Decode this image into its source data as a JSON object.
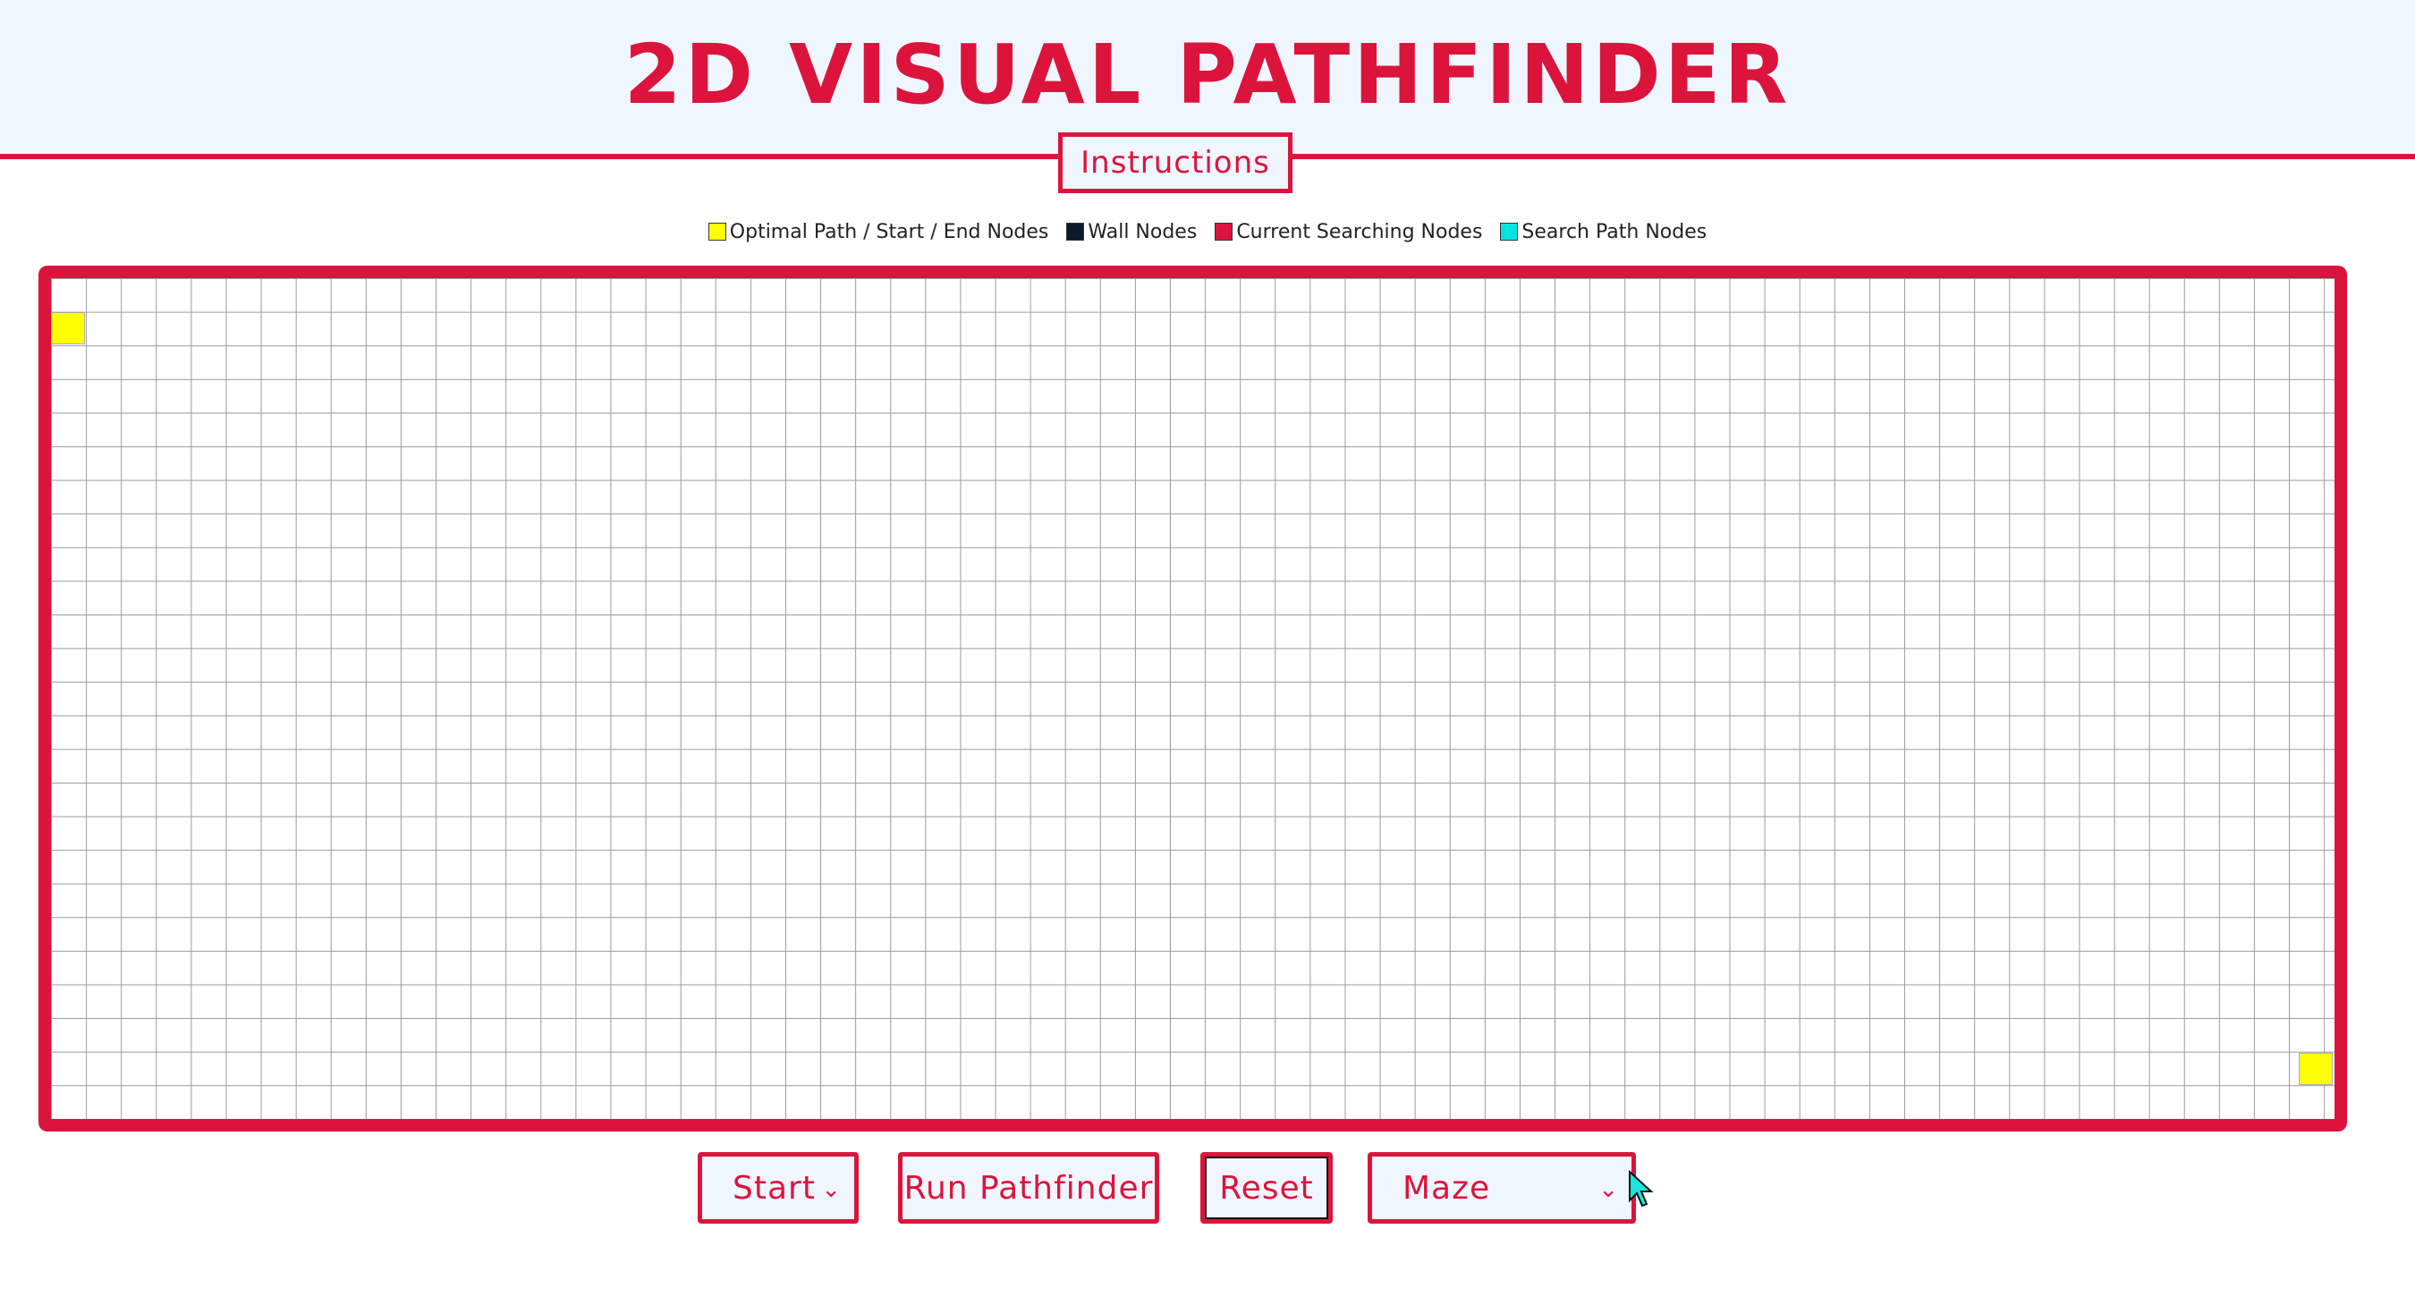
{
  "header": {
    "title": "2D VISUAL PATHFINDER",
    "instructions_label": "Instructions"
  },
  "legend": [
    {
      "label": "Optimal Path / Start / End Nodes",
      "color": "#ffff00"
    },
    {
      "label": "Wall Nodes",
      "color": "#0c1a2b"
    },
    {
      "label": "Current Searching Nodes",
      "color": "#dc143c"
    },
    {
      "label": "Search Path Nodes",
      "color": "#00e5e0"
    }
  ],
  "grid": {
    "columns": 66,
    "rows": 25,
    "start_node": {
      "row": 1,
      "col": 0
    },
    "end_node": {
      "row": 23,
      "col": 65
    }
  },
  "controls": {
    "algorithm_select": "Start",
    "run_label": "Run Pathfinder",
    "reset_label": "Reset",
    "maze_select": "Maze"
  },
  "colors": {
    "accent": "#dc143c",
    "header_bg": "#f0f6ff",
    "node_yellow": "#ffff00"
  }
}
